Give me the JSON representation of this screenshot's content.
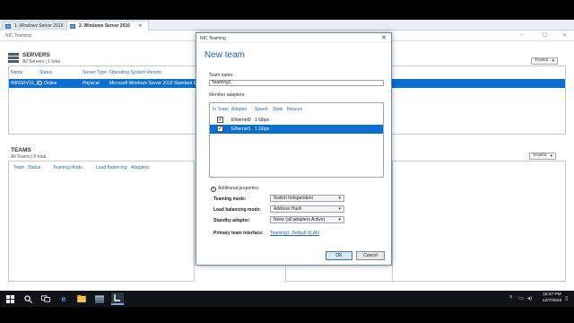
{
  "vm_tabs": [
    {
      "label": "1. Windows Server 2016",
      "active": false
    },
    {
      "label": "2. Windows Server 2016",
      "active": true
    }
  ],
  "background_window": {
    "title": "NIC Teaming",
    "controls": {
      "min": "–",
      "max": "☐",
      "close": "✕"
    },
    "servers": {
      "title": "SERVERS",
      "subtitle": "All Servers | 1 total",
      "tasks_label": "TASKS",
      "columns": [
        "Name",
        "Status",
        "Server Type",
        "Operating System Version"
      ],
      "row": {
        "name": "WINSRV16_2",
        "status": "Online",
        "server_type": "Physical",
        "os": "Microsoft Windows Server 2016 Standard E"
      }
    },
    "teams": {
      "title": "TEAMS",
      "subtitle": "All Teams | 0 total",
      "tasks_label": "TASKS",
      "columns": [
        "Team",
        "Status",
        "Teaming Mode",
        "Load Balancing",
        "Adapters"
      ]
    }
  },
  "dialog": {
    "title": "NIC Teaming",
    "heading": "New team",
    "team_name_label": "Team name:",
    "team_name_value": "Teaming1",
    "member_adapters_label": "Member adapters:",
    "adapter_columns": [
      "In Team",
      "Adapter",
      "Speed",
      "State",
      "Reason"
    ],
    "adapters": [
      {
        "checked": true,
        "adapter": "Ethernet0",
        "speed": "1 Gbps",
        "selected": false
      },
      {
        "checked": true,
        "adapter": "Ethernet1",
        "speed": "1 Gbps",
        "selected": true
      }
    ],
    "additional_properties_label": "Additional properties",
    "props": {
      "teaming_mode_label": "Teaming mode:",
      "teaming_mode_value": "Switch Independent",
      "load_balancing_label": "Load balancing mode:",
      "load_balancing_value": "Address Hash",
      "standby_label": "Standby adapter:",
      "standby_value": "None (all adapters Active)",
      "primary_interface_label": "Primary team interface:",
      "primary_interface_value": "Teaming1: Default VLAN"
    },
    "ok_label": "OK",
    "cancel_label": "Cancel"
  },
  "taskbar": {
    "time": "10:27 PM",
    "date": "12/7/2019"
  },
  "colors": {
    "accent": "#1f63b8",
    "selection": "#0a6fd0",
    "taskbar": "#101318"
  }
}
